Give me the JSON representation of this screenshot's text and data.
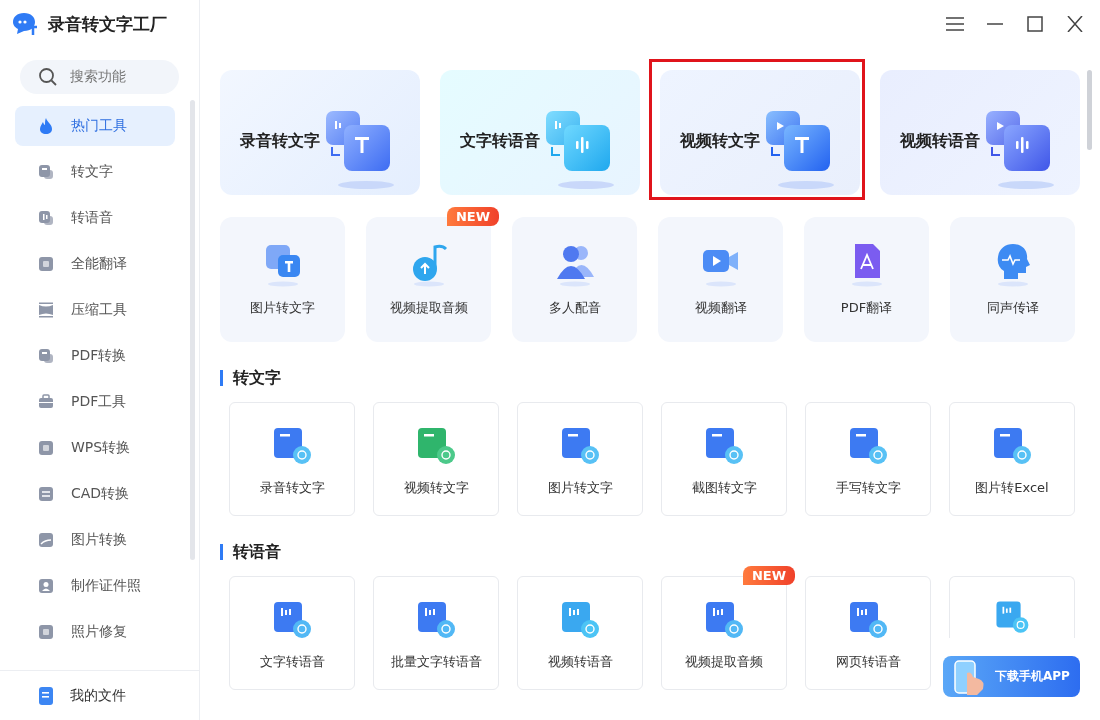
{
  "app": {
    "title": "录音转文字工厂"
  },
  "sidebar": {
    "search": {
      "placeholder": "搜索功能"
    },
    "items": [
      {
        "label": "热门工具",
        "kind": "fire",
        "selected": true
      },
      {
        "label": "转文字",
        "kind": "a",
        "selected": false
      },
      {
        "label": "转语音",
        "kind": "wave",
        "selected": false
      },
      {
        "label": "全能翻译",
        "kind": "square",
        "selected": false
      },
      {
        "label": "压缩工具",
        "kind": "compress",
        "selected": false
      },
      {
        "label": "PDF转换",
        "kind": "a",
        "selected": false
      },
      {
        "label": "PDF工具",
        "kind": "case",
        "selected": false
      },
      {
        "label": "WPS转换",
        "kind": "square",
        "selected": false
      },
      {
        "label": "CAD转换",
        "kind": "swap",
        "selected": false
      },
      {
        "label": "图片转换",
        "kind": "image",
        "selected": false
      },
      {
        "label": "制作证件照",
        "kind": "person",
        "selected": false
      },
      {
        "label": "照片修复",
        "kind": "square",
        "selected": false
      }
    ],
    "footer": {
      "label": "我的文件"
    }
  },
  "featured": [
    {
      "title": "录音转文字",
      "kind": "audio-text",
      "highlighted": false
    },
    {
      "title": "文字转语音",
      "kind": "text-audio",
      "highlighted": false
    },
    {
      "title": "视频转文字",
      "kind": "video-text",
      "highlighted": true
    },
    {
      "title": "视频转语音",
      "kind": "video-audio",
      "highlighted": false
    }
  ],
  "quick_tools": [
    {
      "label": "图片转文字",
      "kind": "image"
    },
    {
      "label": "视频提取音频",
      "kind": "note",
      "badge": "NEW"
    },
    {
      "label": "多人配音",
      "kind": "people"
    },
    {
      "label": "视频翻译",
      "kind": "camera"
    },
    {
      "label": "PDF翻译",
      "kind": "doc"
    },
    {
      "label": "同声传译",
      "kind": "head"
    }
  ],
  "sections": [
    {
      "title": "转文字",
      "tools": [
        {
          "label": "录音转文字",
          "kind": "text"
        },
        {
          "label": "视频转文字",
          "kind": "text-green"
        },
        {
          "label": "图片转文字",
          "kind": "text"
        },
        {
          "label": "截图转文字",
          "kind": "text"
        },
        {
          "label": "手写转文字",
          "kind": "text"
        },
        {
          "label": "图片转Excel",
          "kind": "text"
        }
      ]
    },
    {
      "title": "转语音",
      "tools": [
        {
          "label": "文字转语音",
          "kind": "speech"
        },
        {
          "label": "批量文字转语音",
          "kind": "speech"
        },
        {
          "label": "视频转语音",
          "kind": "speech-light"
        },
        {
          "label": "视频提取音频",
          "kind": "speech",
          "badge": "NEW"
        },
        {
          "label": "网页转语音",
          "kind": "speech"
        },
        {
          "kind": "speech-light"
        }
      ]
    }
  ],
  "download_button": {
    "label": "下载手机APP"
  }
}
